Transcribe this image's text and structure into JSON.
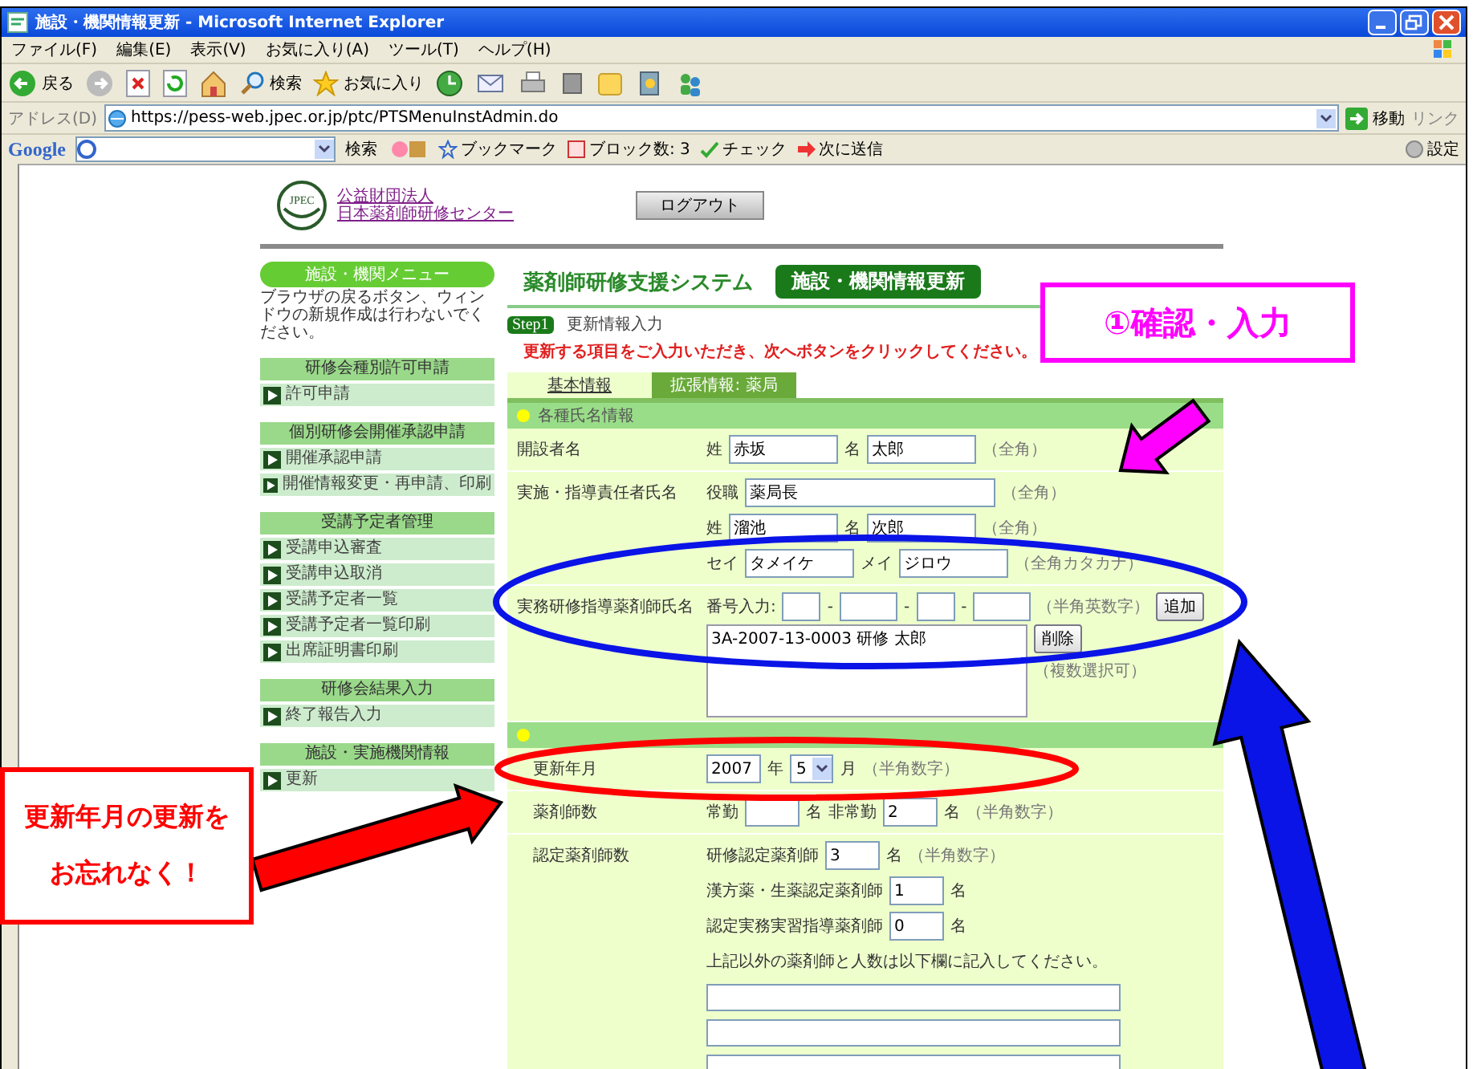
{
  "browser": {
    "title": "施設・機関情報更新 - Microsoft Internet Explorer",
    "menu": [
      "ファイル(F)",
      "編集(E)",
      "表示(V)",
      "お気に入り(A)",
      "ツール(T)",
      "ヘルプ(H)"
    ],
    "toolbar": {
      "back": "戻る",
      "search": "検索",
      "favorites": "お気に入り"
    },
    "address": {
      "label": "アドレス(D)",
      "url": "https://pess-web.jpec.or.jp/ptc/PTSMenuInstAdmin.do",
      "go": "移動",
      "links": "リンク"
    },
    "google_bar": {
      "logo": "Google",
      "search": "検索",
      "bookmarks": "ブックマーク",
      "blocked": "ブロック数: 3",
      "check": "チェック",
      "send": "次に送信",
      "settings": "設定"
    }
  },
  "header": {
    "logo_text": "JPEC",
    "org_type": "公益財団法人",
    "org_name": "日本薬剤師研修センター",
    "logout": "ログアウト"
  },
  "sidebar": {
    "menu_title": "施設・機関メニュー",
    "note": "ブラウザの戻るボタン、ウィンドウの新規作成は行わないでください。",
    "groups": [
      {
        "title": "研修会種別許可申請",
        "items": [
          "許可申請"
        ]
      },
      {
        "title": "個別研修会開催承認申請",
        "items": [
          "開催承認申請",
          "開催情報変更・再申請、印刷"
        ]
      },
      {
        "title": "受講予定者管理",
        "items": [
          "受講申込審査",
          "受講申込取消",
          "受講予定者一覧",
          "受講予定者一覧印刷",
          "出席証明書印刷"
        ]
      },
      {
        "title": "研修会結果入力",
        "items": [
          "終了報告入力"
        ]
      },
      {
        "title": "施設・実施機関情報",
        "items": [
          "更新"
        ]
      }
    ]
  },
  "main": {
    "system_title": "薬剤師研修支援システム",
    "page_badge": "施設・機関情報更新",
    "step": {
      "badge": "Step1",
      "title": "更新情報入力"
    },
    "instruction": "更新する項目をご入力いただき、次へボタンをクリックしてください。",
    "tabs": [
      {
        "label": "基本情報",
        "selected": false
      },
      {
        "label": "拡張情報: 薬局",
        "selected": true
      }
    ],
    "sections": [
      {
        "title": "各種氏名情報",
        "rows": [
          {
            "label": "開設者名",
            "lines": [
              [
                {
                  "kind": "text",
                  "text": "姓"
                },
                {
                  "kind": "input",
                  "value": "赤坂"
                },
                {
                  "kind": "text",
                  "text": "名"
                },
                {
                  "kind": "input",
                  "value": "太郎"
                },
                {
                  "kind": "note",
                  "text": "（全角）"
                }
              ]
            ]
          },
          {
            "label": "実施・指導責任者氏名",
            "lines": [
              [
                {
                  "kind": "text",
                  "text": "役職"
                },
                {
                  "kind": "wide-input",
                  "value": "薬局長"
                },
                {
                  "kind": "note",
                  "text": "（全角）"
                }
              ],
              [
                {
                  "kind": "text",
                  "text": "姓"
                },
                {
                  "kind": "input",
                  "value": "溜池"
                },
                {
                  "kind": "text",
                  "text": "名"
                },
                {
                  "kind": "input",
                  "value": "次郎"
                },
                {
                  "kind": "note",
                  "text": "（全角）"
                }
              ],
              [
                {
                  "kind": "text",
                  "text": "セイ"
                },
                {
                  "kind": "input",
                  "value": "タメイケ"
                },
                {
                  "kind": "text",
                  "text": "メイ"
                },
                {
                  "kind": "input",
                  "value": "ジロウ"
                },
                {
                  "kind": "note",
                  "text": "（全角カタカナ）"
                }
              ]
            ]
          },
          {
            "label": "実務研修指導薬剤師氏名",
            "lines": [
              [
                {
                  "kind": "text",
                  "text": "番号入力:"
                },
                {
                  "kind": "tiny-input"
                },
                {
                  "kind": "text",
                  "text": "-"
                },
                {
                  "kind": "medium-input"
                },
                {
                  "kind": "text",
                  "text": "-"
                },
                {
                  "kind": "tiny-input"
                },
                {
                  "kind": "text",
                  "text": "-"
                },
                {
                  "kind": "medium-input"
                },
                {
                  "kind": "note",
                  "text": "（半角英数字）"
                },
                {
                  "kind": "button",
                  "text": "追加"
                }
              ],
              [
                {
                  "kind": "listbox",
                  "options": [
                    "3A-2007-13-0003 研修 太郎"
                  ],
                  "side": [
                    {
                      "kind": "button",
                      "text": "削除"
                    },
                    {
                      "kind": "note",
                      "text": "（複数選択可）"
                    }
                  ]
                }
              ]
            ]
          }
        ]
      },
      {
        "rows": [
          {
            "label": "更新年月",
            "lines": [
              [
                {
                  "kind": "small-input",
                  "value": "2007"
                },
                {
                  "kind": "text",
                  "text": "年"
                },
                {
                  "kind": "select",
                  "value": "5"
                },
                {
                  "kind": "text",
                  "text": "月"
                },
                {
                  "kind": "note",
                  "text": "（半角数字）"
                }
              ]
            ]
          },
          {
            "label": "薬剤師数",
            "lines": [
              [
                {
                  "kind": "text",
                  "text": "常勤"
                },
                {
                  "kind": "small-input"
                },
                {
                  "kind": "text",
                  "text": "名"
                },
                {
                  "kind": "text",
                  "text": "非常勤"
                },
                {
                  "kind": "small-input",
                  "value": "2"
                },
                {
                  "kind": "text",
                  "text": "名"
                },
                {
                  "kind": "note",
                  "text": "（半角数字）"
                }
              ]
            ]
          },
          {
            "label": "認定薬剤師数",
            "lines": [
              [
                {
                  "kind": "text",
                  "text": "研修認定薬剤師"
                },
                {
                  "kind": "small-input",
                  "value": "3"
                },
                {
                  "kind": "text",
                  "text": "名"
                },
                {
                  "kind": "note",
                  "text": "（半角数字）"
                }
              ],
              [
                {
                  "kind": "text",
                  "text": "漢方薬・生薬認定薬剤師"
                },
                {
                  "kind": "small-input",
                  "value": "1"
                },
                {
                  "kind": "text",
                  "text": "名"
                }
              ],
              [
                {
                  "kind": "text",
                  "text": "認定実務実習指導薬剤師"
                },
                {
                  "kind": "small-input",
                  "value": "0"
                },
                {
                  "kind": "text",
                  "text": "名"
                }
              ],
              [
                {
                  "kind": "text",
                  "text": "上記以外の薬剤師と人数は以下欄に記入してください。"
                }
              ],
              [
                {
                  "kind": "full-input"
                }
              ],
              [
                {
                  "kind": "full-input"
                }
              ],
              [
                {
                  "kind": "full-input"
                }
              ]
            ]
          }
        ]
      }
    ]
  },
  "annotations": {
    "callouts": [
      {
        "lines": [
          "①確認・入力"
        ],
        "color": "#ff00ff"
      },
      {
        "lines": [
          "更新年月の更新を",
          "お忘れなく！"
        ],
        "color": "#ff0000"
      }
    ],
    "marks": [
      {
        "kind": "ellipse",
        "color": "#0a14e6"
      },
      {
        "kind": "arrow",
        "color": "#0a14e6"
      },
      {
        "kind": "ellipse",
        "color": "#ff0000"
      },
      {
        "kind": "arrow",
        "color": "#ff0000"
      },
      {
        "kind": "arrow",
        "color": "#ff00ff"
      }
    ]
  }
}
